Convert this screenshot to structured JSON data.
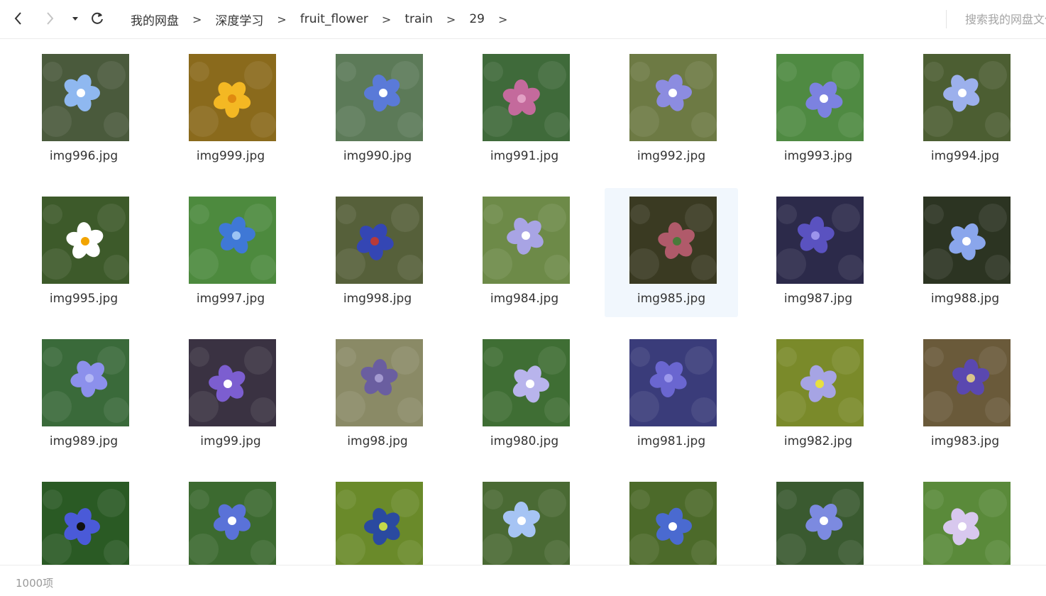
{
  "toolbar": {
    "back_icon": "chevron-left-icon",
    "forward_icon": "chevron-right-icon",
    "history_icon": "caret-down-icon",
    "refresh_icon": "refresh-icon"
  },
  "breadcrumb": {
    "items": [
      "我的网盘",
      "深度学习",
      "fruit_flower",
      "train",
      "29"
    ],
    "separator": ">"
  },
  "search": {
    "placeholder": "搜索我的网盘文件"
  },
  "files": [
    {
      "name": "img996.jpg",
      "bg": "#4a5a3c",
      "flower": "#8fb8f0",
      "accent": "#ffffff"
    },
    {
      "name": "img999.jpg",
      "bg": "#8a6a1c",
      "flower": "#f4b823",
      "accent": "#e08a10"
    },
    {
      "name": "img990.jpg",
      "bg": "#5c7a58",
      "flower": "#5a7ad8",
      "accent": "#ffffff"
    },
    {
      "name": "img991.jpg",
      "bg": "#3f6a3a",
      "flower": "#c46a9c",
      "accent": "#e2a0c4"
    },
    {
      "name": "img992.jpg",
      "bg": "#6d7a44",
      "flower": "#8c8ce0",
      "accent": "#ffffff"
    },
    {
      "name": "img993.jpg",
      "bg": "#4f8a42",
      "flower": "#7c82e0",
      "accent": "#ffffff"
    },
    {
      "name": "img994.jpg",
      "bg": "#4c5e32",
      "flower": "#9cb0ec",
      "accent": "#ffffff"
    },
    {
      "name": "img995.jpg",
      "bg": "#3d5a2a",
      "flower": "#ffffff",
      "accent": "#f2a400"
    },
    {
      "name": "img997.jpg",
      "bg": "#4d8a3e",
      "flower": "#3f78d6",
      "accent": "#9cc4f4"
    },
    {
      "name": "img998.jpg",
      "bg": "#56603a",
      "flower": "#3446b4",
      "accent": "#b83a3a"
    },
    {
      "name": "img984.jpg",
      "bg": "#6d8a48",
      "flower": "#a8a4e4",
      "accent": "#ffffff"
    },
    {
      "name": "img985.jpg",
      "bg": "#3a3a22",
      "flower": "#b05a6a",
      "accent": "#4a7a3a",
      "selected": true
    },
    {
      "name": "img987.jpg",
      "bg": "#2c2a4a",
      "flower": "#5a52c0",
      "accent": "#9c94ec"
    },
    {
      "name": "img988.jpg",
      "bg": "#2c3422",
      "flower": "#8aa6ec",
      "accent": "#ffffff"
    },
    {
      "name": "img989.jpg",
      "bg": "#3a6a3a",
      "flower": "#8c90ec",
      "accent": "#b4b8f6"
    },
    {
      "name": "img99.jpg",
      "bg": "#3a3242",
      "flower": "#7c5ed0",
      "accent": "#ffffff"
    },
    {
      "name": "img98.jpg",
      "bg": "#8a8a66",
      "flower": "#6a5ea0",
      "accent": "#a49ad0"
    },
    {
      "name": "img980.jpg",
      "bg": "#3f6e34",
      "flower": "#b8b4ec",
      "accent": "#ffffff"
    },
    {
      "name": "img981.jpg",
      "bg": "#3a3c7a",
      "flower": "#6a66d0",
      "accent": "#9c98ec"
    },
    {
      "name": "img982.jpg",
      "bg": "#7a8a2a",
      "flower": "#a6a4e4",
      "accent": "#e8e040"
    },
    {
      "name": "img983.jpg",
      "bg": "#6a5a3a",
      "flower": "#5a48b0",
      "accent": "#d8c48a"
    },
    {
      "name": "",
      "bg": "#2a5a24",
      "flower": "#4a5ad8",
      "accent": "#111111"
    },
    {
      "name": "",
      "bg": "#3c6a30",
      "flower": "#5a72d8",
      "accent": "#ffffff"
    },
    {
      "name": "",
      "bg": "#6a8a2a",
      "flower": "#2a4aa0",
      "accent": "#c4d84a"
    },
    {
      "name": "",
      "bg": "#4a6a34",
      "flower": "#a6c4f4",
      "accent": "#ffffff"
    },
    {
      "name": "",
      "bg": "#4c6a2a",
      "flower": "#4a6ad0",
      "accent": "#ffffff"
    },
    {
      "name": "",
      "bg": "#3a5a30",
      "flower": "#7c8ae0",
      "accent": "#ffffff"
    },
    {
      "name": "",
      "bg": "#5a8a3a",
      "flower": "#d8c8ee",
      "accent": "#ffffff"
    }
  ],
  "status": {
    "count": "1000项"
  }
}
